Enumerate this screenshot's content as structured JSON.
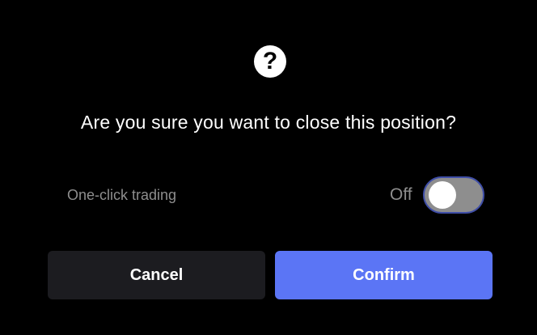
{
  "dialog": {
    "icon": "question-circle-icon",
    "icon_glyph": "?",
    "title": "Are you sure you want to close this position?",
    "option": {
      "label": "One-click trading",
      "state_text": "Off",
      "enabled": false
    },
    "cancel_label": "Cancel",
    "confirm_label": "Confirm"
  },
  "colors": {
    "background": "#000000",
    "cancel_button": "#1c1c20",
    "confirm_button": "#5b75f5",
    "toggle_track": "#8e8e8e",
    "toggle_border": "#3f4ea8",
    "muted_text": "#8e8e8e"
  }
}
